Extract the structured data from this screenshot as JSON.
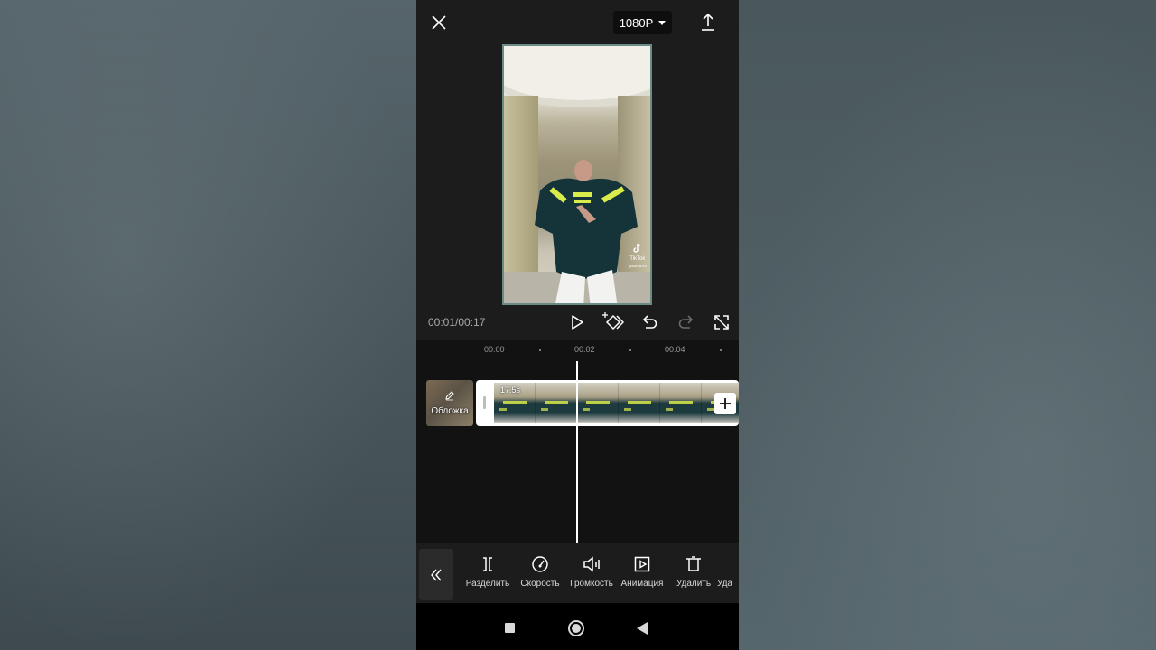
{
  "header": {
    "resolution_label": "1080P",
    "close_icon": "close-icon",
    "export_icon": "export-icon"
  },
  "preview": {
    "watermark_brand": "TikTok",
    "watermark_handle": "@korna.no"
  },
  "transport": {
    "timecode": "00:01/00:17",
    "icons": [
      "play-icon",
      "add-keyframe-icon",
      "undo-icon",
      "redo-icon",
      "fullscreen-icon"
    ]
  },
  "timeline": {
    "ruler": [
      "00:00",
      "00:02",
      "00:04"
    ],
    "cover_label": "Обложка",
    "clip_duration": "17.5s"
  },
  "toolbar": {
    "tools": [
      {
        "label": "Разделить",
        "icon": "split-icon"
      },
      {
        "label": "Скорость",
        "icon": "speed-icon"
      },
      {
        "label": "Громкость",
        "icon": "volume-icon"
      },
      {
        "label": "Анимация",
        "icon": "animation-icon"
      },
      {
        "label": "Удалить",
        "icon": "delete-icon"
      },
      {
        "label": "Уда",
        "icon": "delete-icon"
      }
    ]
  },
  "navbar": {
    "icons": [
      "recents-icon",
      "home-icon",
      "back-icon"
    ]
  },
  "colors": {
    "panel_bg": "#1c1c1c",
    "timeline_bg": "#121212",
    "preview_border": "#6b8c86",
    "text_muted": "#a9a9a9"
  }
}
